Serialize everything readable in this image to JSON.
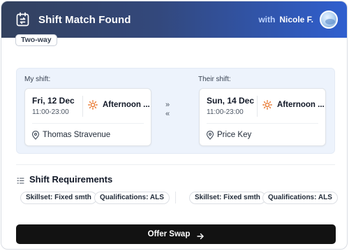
{
  "header": {
    "title": "Shift Match Found",
    "with_label": "with",
    "user_name": "Nicole F.",
    "title_icon": "calendar-swap-icon",
    "gradient_start": "#33415e",
    "gradient_end": "#2f5fcf"
  },
  "badge": "Two-way",
  "my_shift": {
    "label": "My shift:",
    "date": "Fri, 12 Dec",
    "time": "11:00-23:00",
    "period": "Afternoon ...",
    "location": "Thomas Stravenue"
  },
  "their_shift": {
    "label": "Their shift:",
    "date": "Sun, 14 Dec",
    "time": "11:00-23:00",
    "period": "Afternoon ...",
    "location": "Price Key"
  },
  "swap_arrows": {
    "forward": "»",
    "back": "«"
  },
  "requirements": {
    "title": "Shift Requirements",
    "mine": [
      "Skillset: Fixed smth",
      "Qualifications: ALS"
    ],
    "theirs": [
      "Skillset: Fixed smth",
      "Qualifications: ALS"
    ]
  },
  "action": {
    "label": "Offer Swap",
    "button_color": "#121212"
  },
  "colors": {
    "sun_icon": "#e8772e",
    "panel_bg": "#edf3fc"
  }
}
